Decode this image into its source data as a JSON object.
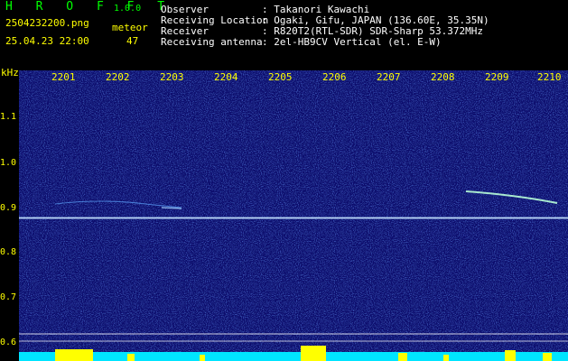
{
  "header": {
    "app_title": "H R O F F T",
    "app_version": "1.0.0",
    "filename": "2504232200.png",
    "datetime": "25.04.23 22:00",
    "meteor_label": "meteor",
    "meteor_count": "47"
  },
  "info": [
    {
      "key": "Observer",
      "value": ": Takanori Kawachi"
    },
    {
      "key": "Receiving Location",
      "value": ": Ogaki, Gifu, JAPAN (136.60E, 35.35N)"
    },
    {
      "key": "Receiver",
      "value": ": R820T2(RTL-SDR) SDR-Sharp 53.372MHz"
    },
    {
      "key": "Receiving antenna",
      "value": ": 2el-HB9CV Vertical (el. E-W)"
    }
  ],
  "axis": {
    "unit": "kHz",
    "y_labels": [
      "1.1",
      "1.0",
      "0.9",
      "0.8",
      "0.7",
      "0.6"
    ],
    "x_labels": [
      "2201",
      "2202",
      "2203",
      "2204",
      "2205",
      "2206",
      "2207",
      "2208",
      "2209",
      "2210"
    ]
  },
  "colors": {
    "background": "#0b0f6e",
    "carrier": "#ffffff",
    "labels": "#ffff00",
    "title": "#00ff00"
  }
}
